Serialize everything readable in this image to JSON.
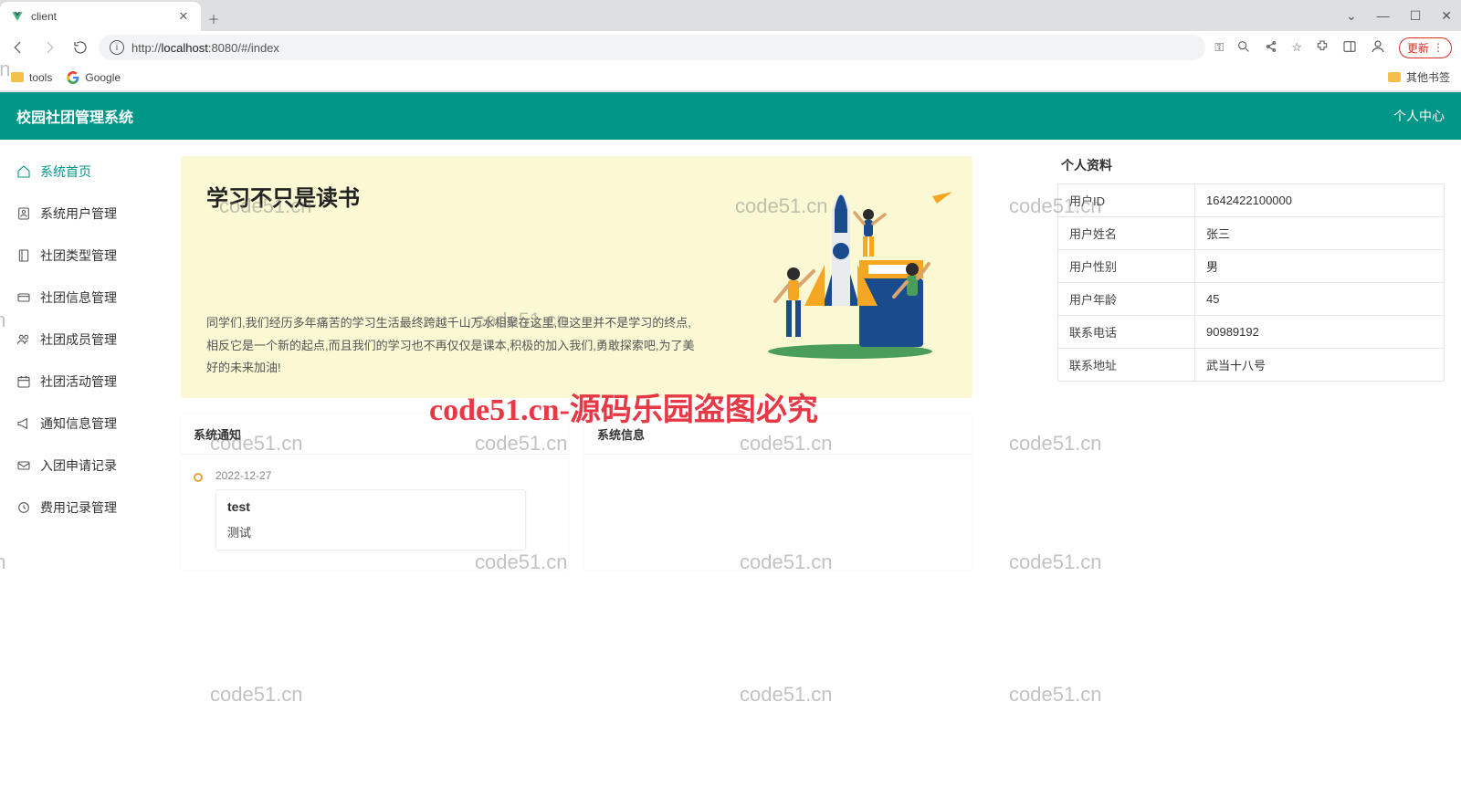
{
  "browser": {
    "tab_title": "client",
    "url_prefix": "http://",
    "url_host": "localhost",
    "url_rest": ":8080/#/index",
    "update_label": "更新",
    "bookmarks": {
      "tools": "tools",
      "google": "Google",
      "other": "其他书签"
    }
  },
  "app": {
    "title": "校园社团管理系统",
    "user_menu": "个人中心"
  },
  "sidebar": {
    "items": [
      {
        "label": "系统首页"
      },
      {
        "label": "系统用户管理"
      },
      {
        "label": "社团类型管理"
      },
      {
        "label": "社团信息管理"
      },
      {
        "label": "社团成员管理"
      },
      {
        "label": "社团活动管理"
      },
      {
        "label": "通知信息管理"
      },
      {
        "label": "入团申请记录"
      },
      {
        "label": "费用记录管理"
      }
    ]
  },
  "hero": {
    "title": "学习不只是读书",
    "desc": "同学们,我们经历多年痛苦的学习生活最终跨越千山万水相聚在这里,但这里并不是学习的终点,相反它是一个新的起点,而且我们的学习也不再仅仅是课本,积极的加入我们,勇敢探索吧,为了美好的未来加油!"
  },
  "panels": {
    "notice_title": "系统通知",
    "notice_date": "2022-12-27",
    "notice_card_title": "test",
    "notice_card_body": "测试",
    "info_title": "系统信息"
  },
  "profile": {
    "title": "个人资料",
    "rows": [
      {
        "k": "用户ID",
        "v": "1642422100000"
      },
      {
        "k": "用户姓名",
        "v": "张三"
      },
      {
        "k": "用户性别",
        "v": "男"
      },
      {
        "k": "用户年龄",
        "v": "45"
      },
      {
        "k": "联系电话",
        "v": "90989192"
      },
      {
        "k": "联系地址",
        "v": "武当十八号"
      }
    ]
  },
  "watermarks": {
    "site": "code51.cn",
    "big": "code51.cn-源码乐园盗图必究"
  }
}
